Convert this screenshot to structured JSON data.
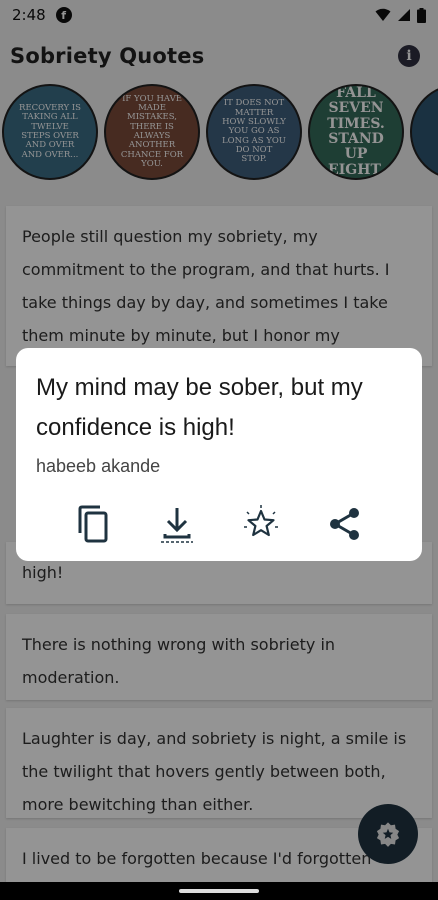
{
  "status_bar": {
    "time": "2:48",
    "notification_icon": "facebook-icon",
    "right_icons": [
      "wifi-icon",
      "signal-icon",
      "battery-icon"
    ]
  },
  "app_bar": {
    "title": "Sobriety Quotes",
    "info_icon": "info-icon"
  },
  "stories": [
    {
      "text": "Recovery is taking all twelve steps over and over and over...",
      "bg": "#3b6d86"
    },
    {
      "text": "If you have made mistakes, there is always another chance for you.",
      "bg": "#7a4a3a"
    },
    {
      "text": "It does not matter how slowly you go as long as you do not stop.",
      "bg": "#3e5f7d"
    },
    {
      "text": "Fall seven times. Stand up eight.",
      "bg": "#356b5a"
    },
    {
      "text": "",
      "bg": "#2e5570"
    }
  ],
  "feed": {
    "cards": [
      {
        "text": "People still question my sobriety, my commitment to the program, and that hurts. I take things day by day, and sometimes I take them minute by minute, but I honor my"
      },
      {
        "text": "high!"
      },
      {
        "text": "There is nothing wrong with sobriety in moderation."
      },
      {
        "text": "Laughter is day, and sobriety is night, a smile is the twilight that hovers gently between both, more bewitching than either."
      },
      {
        "text": "I lived to be forgotten because I'd forgotten"
      }
    ]
  },
  "dialog": {
    "quote": "My mind may be sober, but my confidence is high!",
    "author": "habeeb akande",
    "actions": [
      "copy",
      "download",
      "favorite",
      "share"
    ]
  },
  "colors": {
    "icon_dark": "#1f3340",
    "fab_bg": "#1f3340"
  }
}
